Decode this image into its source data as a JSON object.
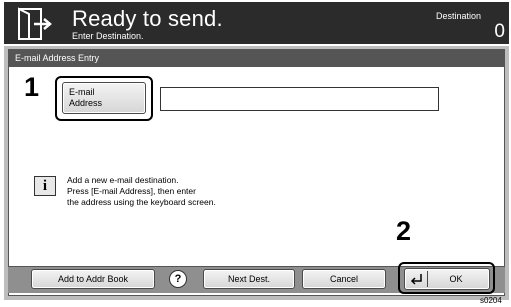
{
  "header": {
    "title": "Ready to send.",
    "subtitle": "Enter Destination.",
    "destination_label": "Destination",
    "destination_count": "0"
  },
  "panel": {
    "title": "E-mail Address Entry",
    "email_button_line1": "E-mail",
    "email_button_line2": "Address",
    "email_value": "",
    "info_lines": [
      "Add a new e-mail destination.",
      "Press [E-mail Address], then enter",
      "the address using the keyboard screen."
    ]
  },
  "steps": {
    "step1": "1",
    "step2": "2"
  },
  "footer": {
    "add_to_addr_book": "Add to Addr Book",
    "help": "?",
    "next_dest": "Next Dest.",
    "cancel": "Cancel",
    "ok": "OK"
  },
  "figure_code": "s0204"
}
